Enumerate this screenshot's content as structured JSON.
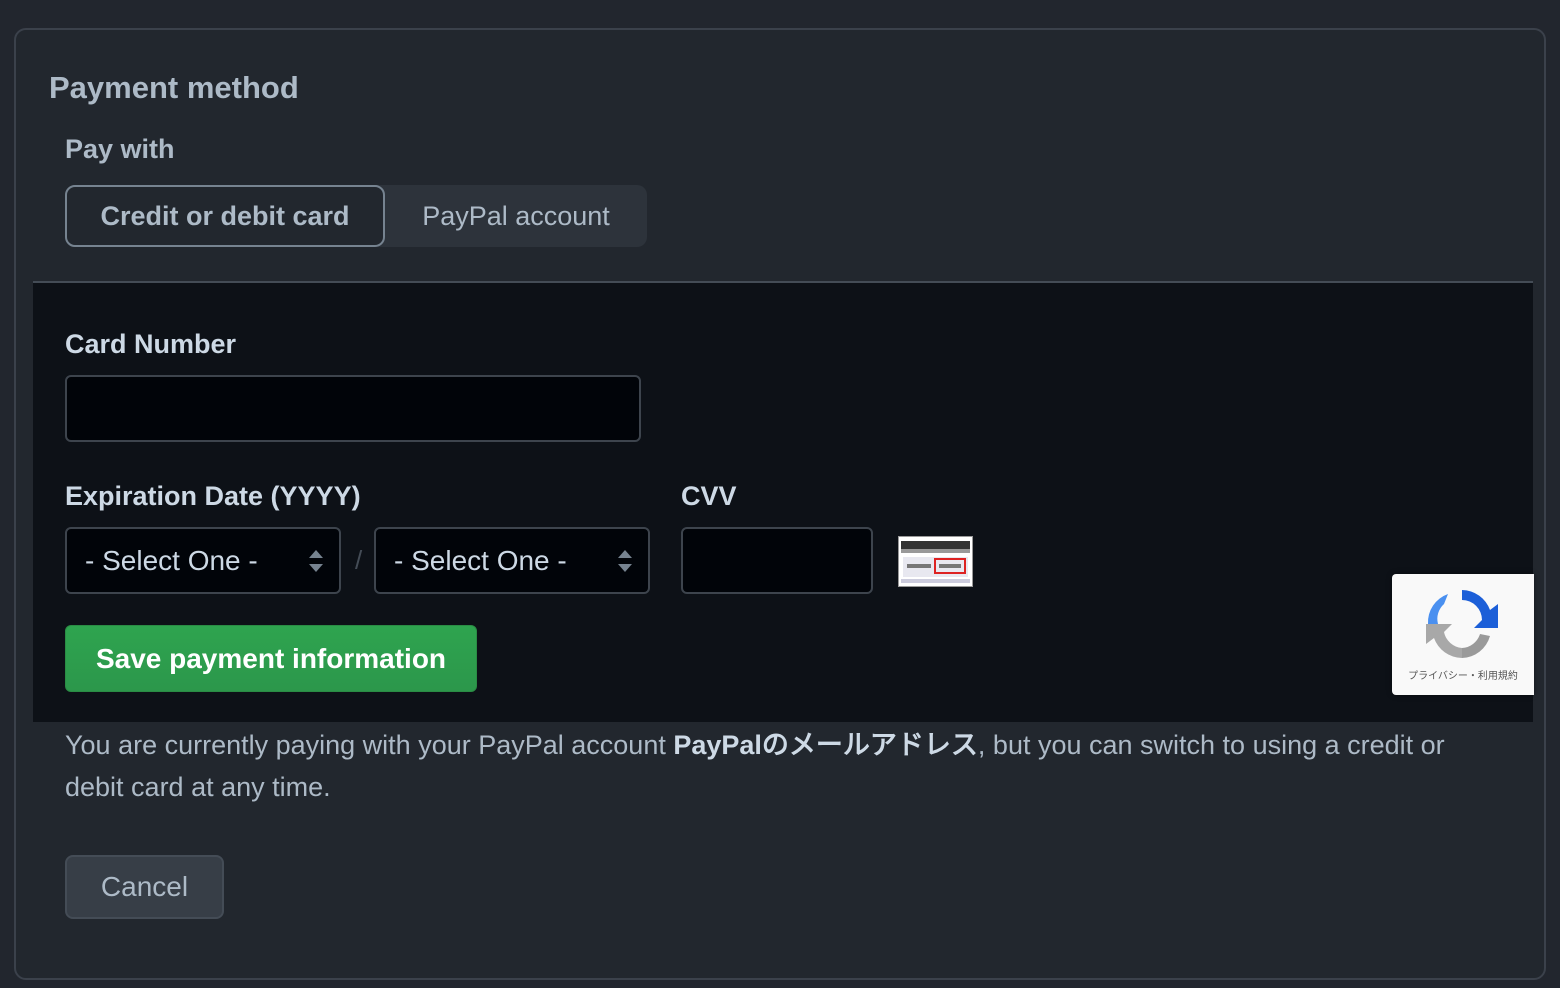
{
  "payment": {
    "title": "Payment method",
    "pay_with_label": "Pay with",
    "options": [
      {
        "label": "Credit or debit card",
        "selected": true
      },
      {
        "label": "PayPal account",
        "selected": false
      }
    ]
  },
  "card_form": {
    "card_number_label": "Card Number",
    "card_number_value": "",
    "expiration_label": "Expiration Date (YYYY)",
    "month_select": "- Select One -",
    "year_select": "- Select One -",
    "separator": "/",
    "cvv_label": "CVV",
    "cvv_value": "",
    "save_button": "Save payment information"
  },
  "recaptcha": {
    "links": "プライバシー・利用規約"
  },
  "info": {
    "prefix": "You are currently paying with your PayPal account ",
    "account": "PayPalのメールアドレス",
    "suffix": ", but you can switch to using a credit or debit card at any time."
  },
  "cancel_button": "Cancel",
  "colors": {
    "accent_green": "#2ea44f",
    "background": "#22272e",
    "card_area": "#0d1117"
  }
}
